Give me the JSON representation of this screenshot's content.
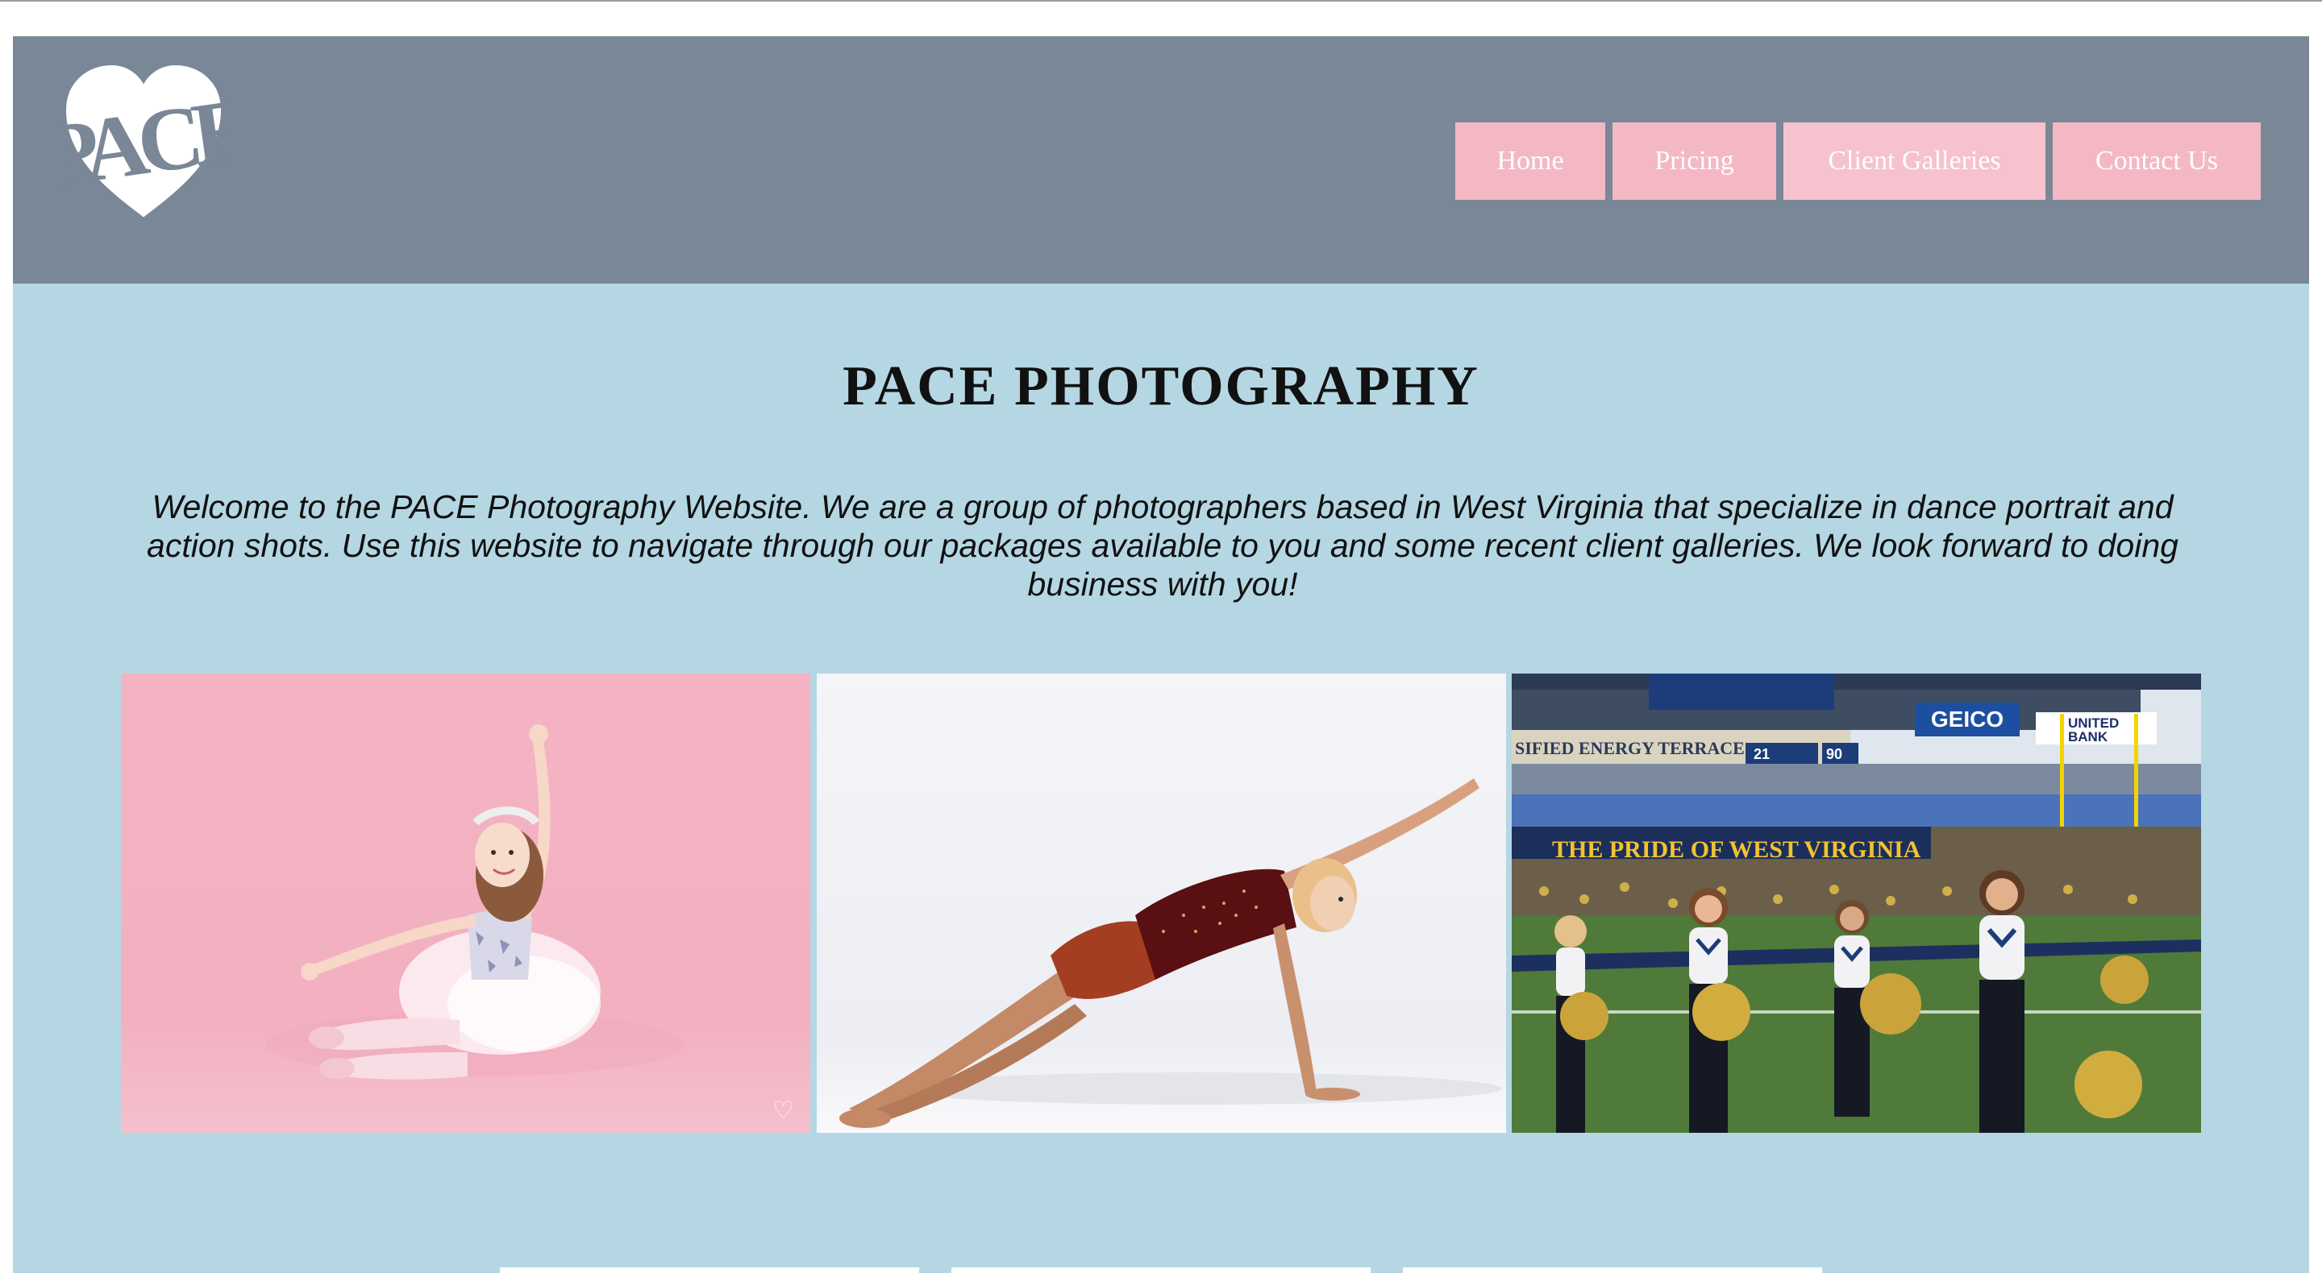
{
  "site": {
    "logo_text": "PACE",
    "nav": [
      {
        "label": "Home"
      },
      {
        "label": "Pricing"
      },
      {
        "label": "Client Galleries"
      },
      {
        "label": "Contact Us"
      }
    ]
  },
  "main": {
    "title": "PACE PHOTOGRAPHY",
    "intro": "Welcome to the PACE Photography Website. We are a group of photographers based in West Virginia that specialize in dance portrait and action shots. Use this website to navigate through our packages available to you and some recent client galleries. We look forward to doing business with you!"
  },
  "gallery": {
    "stadium_signs": [
      "SIFIED ENERGY TERRACE",
      "21",
      "90",
      "GEICO",
      "UNITED",
      "BANK",
      "THE PRIDE OF WEST VIRGINIA"
    ]
  },
  "colors": {
    "header_bg": "#7a8797",
    "page_bg": "#b5d7e3",
    "nav_bg": "#f4b8c5",
    "nav_text": "#ffffff"
  }
}
